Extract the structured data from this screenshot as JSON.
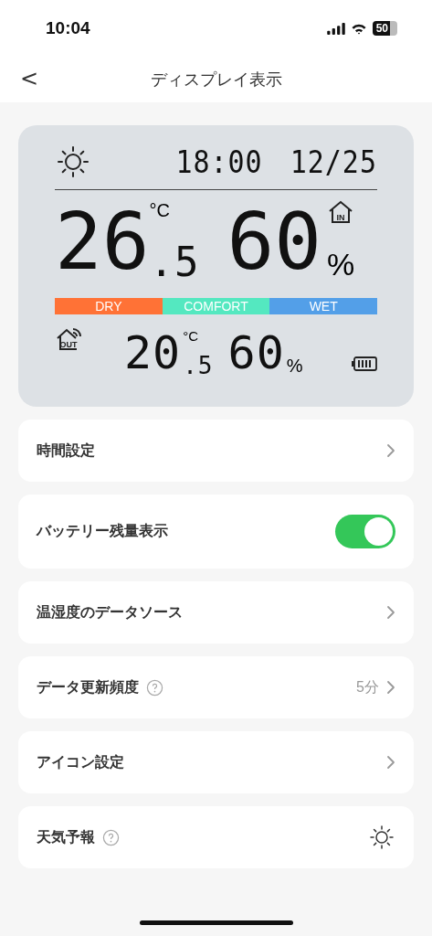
{
  "status_bar": {
    "time": "10:04",
    "battery_text": "50"
  },
  "nav": {
    "back": "<",
    "title": "ディスプレイ表示"
  },
  "display": {
    "time": "18:00",
    "date": "12/25",
    "indoor": {
      "badge": "IN",
      "temp": "26",
      "temp_decimal": ".5",
      "temp_unit": "°C",
      "humidity": "60",
      "humidity_unit": "%"
    },
    "comfort_scale": [
      {
        "label": "DRY",
        "color": "#ff7236"
      },
      {
        "label": "COMFORT",
        "color": "#54e8c0"
      },
      {
        "label": "WET",
        "color": "#539fe8"
      }
    ],
    "outdoor": {
      "badge": "OUT",
      "temp": "20",
      "temp_decimal": ".5",
      "temp_unit": "°C",
      "humidity": "60",
      "humidity_unit": "%"
    }
  },
  "settings": [
    {
      "kind": "link",
      "label": "時間設定",
      "help": false
    },
    {
      "kind": "toggle",
      "label": "バッテリー残量表示",
      "help": false,
      "on": true
    },
    {
      "kind": "link",
      "label": "温湿度のデータソース",
      "help": false
    },
    {
      "kind": "link",
      "label": "データ更新頻度",
      "help": true,
      "value": "5分"
    },
    {
      "kind": "link",
      "label": "アイコン設定",
      "help": false
    },
    {
      "kind": "weather",
      "label": "天気予報",
      "help": true
    }
  ]
}
